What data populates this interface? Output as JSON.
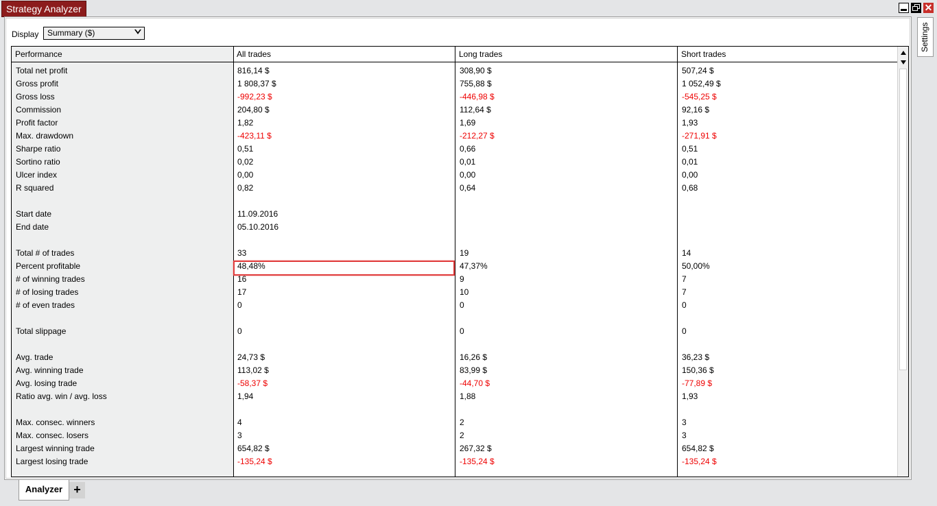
{
  "window": {
    "title": "Strategy Analyzer",
    "close_glyph": "✕"
  },
  "display": {
    "label": "Display",
    "selected": "Summary ($)"
  },
  "side_tab": {
    "label": "Settings"
  },
  "bottom_tabs": {
    "active": "Analyzer",
    "add": "+"
  },
  "colors": {
    "negative": "#e00000",
    "title_bg": "#8c1c1c",
    "highlight": "#e03a3a"
  },
  "table": {
    "headers": [
      "Performance",
      "All trades",
      "Long trades",
      "Short trades"
    ],
    "rows": [
      {
        "label": "Total net profit",
        "all": "816,14 $",
        "long": "308,90 $",
        "short": "507,24 $",
        "neg": false
      },
      {
        "label": "Gross profit",
        "all": "1 808,37 $",
        "long": "755,88 $",
        "short": "1 052,49 $",
        "neg": false
      },
      {
        "label": "Gross loss",
        "all": "-992,23 $",
        "long": "-446,98 $",
        "short": "-545,25 $",
        "neg": true
      },
      {
        "label": "Commission",
        "all": "204,80 $",
        "long": "112,64 $",
        "short": "92,16 $",
        "neg": false
      },
      {
        "label": "Profit factor",
        "all": "1,82",
        "long": "1,69",
        "short": "1,93",
        "neg": false
      },
      {
        "label": "Max. drawdown",
        "all": "-423,11 $",
        "long": "-212,27 $",
        "short": "-271,91 $",
        "neg": true
      },
      {
        "label": "Sharpe ratio",
        "all": "0,51",
        "long": "0,66",
        "short": "0,51",
        "neg": false
      },
      {
        "label": "Sortino ratio",
        "all": "0,02",
        "long": "0,01",
        "short": "0,01",
        "neg": false
      },
      {
        "label": "Ulcer index",
        "all": "0,00",
        "long": "0,00",
        "short": "0,00",
        "neg": false
      },
      {
        "label": "R squared",
        "all": "0,82",
        "long": "0,64",
        "short": "0,68",
        "neg": false
      },
      {
        "label": "",
        "all": "",
        "long": "",
        "short": "",
        "neg": false
      },
      {
        "label": "Start date",
        "all": "11.09.2016",
        "long": "",
        "short": "",
        "neg": false
      },
      {
        "label": "End date",
        "all": "05.10.2016",
        "long": "",
        "short": "",
        "neg": false
      },
      {
        "label": "",
        "all": "",
        "long": "",
        "short": "",
        "neg": false
      },
      {
        "label": "Total # of trades",
        "all": "33",
        "long": "19",
        "short": "14",
        "neg": false
      },
      {
        "label": "Percent profitable",
        "all": "48,48%",
        "long": "47,37%",
        "short": "50,00%",
        "neg": false
      },
      {
        "label": "# of winning trades",
        "all": "16",
        "long": "9",
        "short": "7",
        "neg": false
      },
      {
        "label": "# of losing trades",
        "all": "17",
        "long": "10",
        "short": "7",
        "neg": false
      },
      {
        "label": "# of even trades",
        "all": "0",
        "long": "0",
        "short": "0",
        "neg": false
      },
      {
        "label": "",
        "all": "",
        "long": "",
        "short": "",
        "neg": false
      },
      {
        "label": "Total slippage",
        "all": "0",
        "long": "0",
        "short": "0",
        "neg": false
      },
      {
        "label": "",
        "all": "",
        "long": "",
        "short": "",
        "neg": false
      },
      {
        "label": "Avg. trade",
        "all": "24,73 $",
        "long": "16,26 $",
        "short": "36,23 $",
        "neg": false
      },
      {
        "label": "Avg. winning trade",
        "all": "113,02 $",
        "long": "83,99 $",
        "short": "150,36 $",
        "neg": false
      },
      {
        "label": "Avg. losing trade",
        "all": "-58,37 $",
        "long": "-44,70 $",
        "short": "-77,89 $",
        "neg": true
      },
      {
        "label": "Ratio avg. win / avg. loss",
        "all": "1,94",
        "long": "1,88",
        "short": "1,93",
        "neg": false
      },
      {
        "label": "",
        "all": "",
        "long": "",
        "short": "",
        "neg": false
      },
      {
        "label": "Max. consec. winners",
        "all": "4",
        "long": "2",
        "short": "3",
        "neg": false
      },
      {
        "label": "Max. consec. losers",
        "all": "3",
        "long": "2",
        "short": "3",
        "neg": false
      },
      {
        "label": "Largest winning trade",
        "all": "654,82 $",
        "long": "267,32 $",
        "short": "654,82 $",
        "neg": false
      },
      {
        "label": "Largest losing trade",
        "all": "-135,24 $",
        "long": "-135,24 $",
        "short": "-135,24 $",
        "neg": true
      }
    ]
  }
}
